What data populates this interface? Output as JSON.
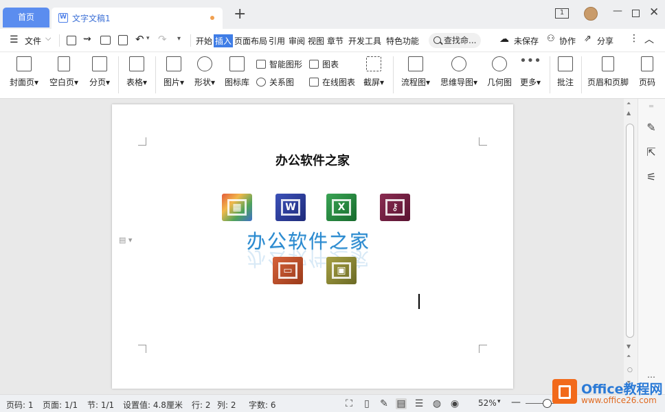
{
  "tabs": {
    "home": "首页",
    "doc": "文字文稿1"
  },
  "window": {
    "page_count_badge": "1"
  },
  "menu": {
    "file": "文件",
    "items": [
      "开始",
      "插入",
      "页面布局",
      "引用",
      "审阅",
      "视图",
      "章节",
      "开发工具",
      "特色功能"
    ],
    "active": "插入",
    "search": "查找命...",
    "unsaved": "未保存",
    "collab": "协作",
    "share": "分享"
  },
  "ribbon": {
    "cover": "封面页",
    "blank": "空白页",
    "pagebreak": "分页",
    "table": "表格",
    "picture": "图片",
    "shape": "形状",
    "iconlib": "图标库",
    "smartart": "智能图形",
    "chart": "图表",
    "relation": "关系图",
    "onlinechart": "在线图表",
    "screenshot": "截屏",
    "flowchart": "流程图",
    "mindmap": "思维导图",
    "geometry": "几何图",
    "more": "更多",
    "comment": "批注",
    "headerfooter": "页眉和页脚",
    "pagenum": "页码"
  },
  "document": {
    "title": "办公软件之家",
    "art_text": "办公软件之家"
  },
  "status": {
    "page_num": "页码: 1",
    "pages": "页面: 1/1",
    "section": "节: 1/1",
    "setting": "设置值: 4.8厘米",
    "row": "行: 2",
    "col": "列: 2",
    "words": "字数: 6",
    "zoom": "52%"
  },
  "watermark": {
    "brand": "Office教程网",
    "url": "www.office26.com"
  },
  "colors": {
    "accent": "#3f7de6",
    "tab_home": "#5b8def",
    "art_blue": "#2b8ad0",
    "brand_orange": "#f26a1b"
  }
}
